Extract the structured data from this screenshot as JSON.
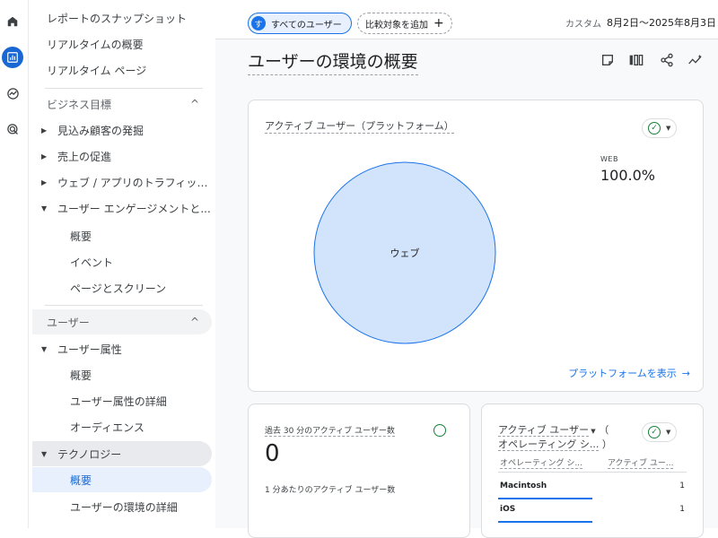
{
  "rail": {
    "items": [
      {
        "icon": "home-icon"
      },
      {
        "icon": "reports-icon"
      },
      {
        "icon": "explore-icon"
      },
      {
        "icon": "advertising-icon"
      }
    ]
  },
  "sidebar": {
    "snapshot": "レポートのスナップショット",
    "realtime_overview": "リアルタイムの概要",
    "realtime_pages": "リアルタイム ページ",
    "business_section": "ビジネス目標",
    "lead_gen": "見込み顧客の発掘",
    "sales": "売上の促進",
    "traffic": "ウェブ / アプリのトラフィック...",
    "engagement": "ユーザー エンゲージメントと...",
    "overview1": "概要",
    "events": "イベント",
    "pages_screens": "ページとスクリーン",
    "user_section": "ユーザー",
    "user_attr": "ユーザー属性",
    "overview2": "概要",
    "user_attr_detail": "ユーザー属性の詳細",
    "audiences": "オーディエンス",
    "tech": "テクノロジー",
    "overview3": "概要",
    "env_detail": "ユーザーの環境の詳細"
  },
  "topbar": {
    "avatar_letter": "す",
    "all_users": "すべてのユーザー",
    "add_compare": "比較対象を追加",
    "custom": "カスタム",
    "date_range": "8月2日～2025年8月3日"
  },
  "page": {
    "title": "ユーザーの環境の概要"
  },
  "platform_card": {
    "title": "アクティブ ユーザー（プラットフォーム）",
    "pie_label": "ウェブ",
    "legend_name": "WEB",
    "legend_value": "100.0%",
    "view_link": "プラットフォームを表示"
  },
  "realtime_card": {
    "title": "過去 30 分のアクティブ ユーザー数",
    "value": "0",
    "sub_label": "1 分あたりのアクティブ ユーザー数"
  },
  "os_card": {
    "title_line1": "アクティブ ユーザー",
    "title_paren_open": "（",
    "title_line2": "オペレーティング シ...",
    "title_paren_close": "）",
    "col1": "オペレーティング シ...",
    "col2": "アクティブ ユー...",
    "rows": [
      {
        "name": "Macintosh",
        "value": "1"
      },
      {
        "name": "iOS",
        "value": "1"
      }
    ]
  },
  "chart_data": {
    "type": "pie",
    "title": "アクティブ ユーザー（プラットフォーム）",
    "categories": [
      "ウェブ"
    ],
    "values": [
      100.0
    ],
    "legend": [
      "WEB"
    ],
    "colors": [
      "#d2e3fc"
    ]
  },
  "colors": {
    "accent": "#1a73e8",
    "pie_fill": "#d2e3fc",
    "pie_stroke": "#1a73e8",
    "check_green": "#188038"
  }
}
